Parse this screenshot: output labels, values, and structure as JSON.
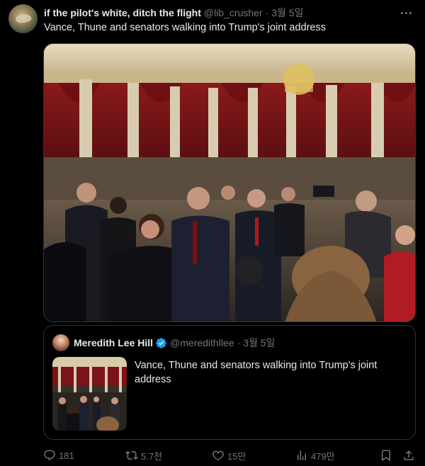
{
  "tweet": {
    "display_name": "if the pilot's white, ditch the flight",
    "handle": "@lib_crusher",
    "separator": "·",
    "date": "3월 5일",
    "text": "Vance, Thune and senators walking into Trump's joint address"
  },
  "quoted": {
    "display_name": "Meredith Lee Hill",
    "handle": "@meredithllee",
    "separator": "·",
    "date": "3월 5일",
    "text": "Vance, Thune and senators walking into Trump's joint address"
  },
  "actions": {
    "replies": "181",
    "retweets": "5.7천",
    "likes": "15만",
    "views": "479만"
  },
  "colors": {
    "background": "#000000",
    "text_primary": "#e7e9ea",
    "text_secondary": "#71767b",
    "border": "#2f3336",
    "verified": "#1d9bf0"
  },
  "icons": [
    "more-icon",
    "verified-icon",
    "reply-icon",
    "retweet-icon",
    "like-icon",
    "views-icon",
    "bookmark-icon",
    "share-icon"
  ]
}
